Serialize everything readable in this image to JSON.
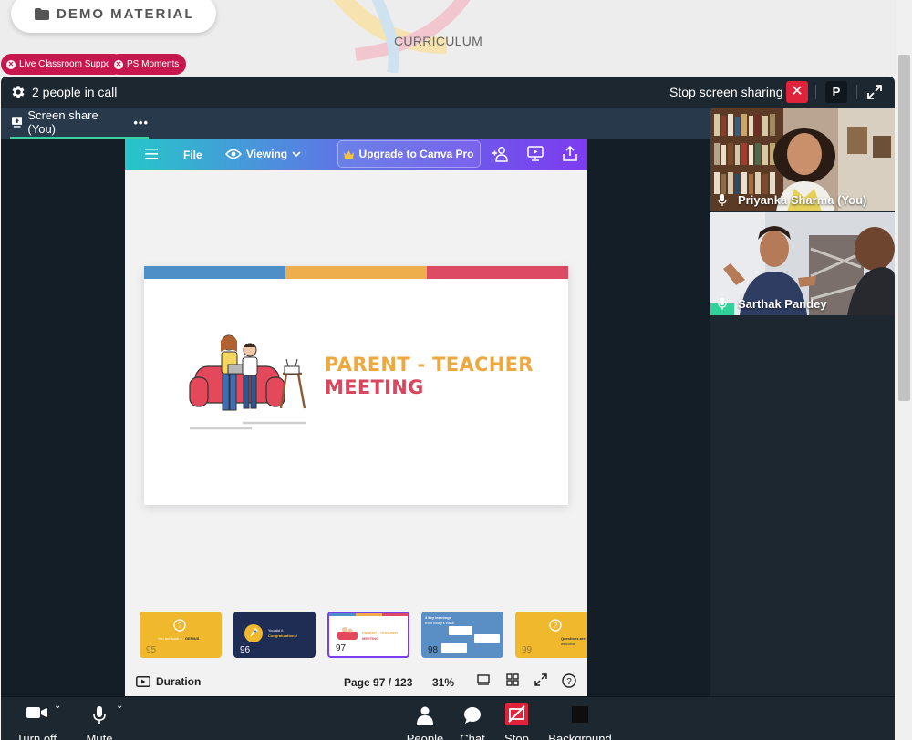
{
  "page": {
    "demo_button_label": "DEMO MATERIAL",
    "curriculum_label": "CURRICULUM",
    "chips": [
      {
        "label": "Live Classroom Support"
      },
      {
        "label": "PS Moments"
      }
    ]
  },
  "call": {
    "people_count_text": "2 people in call",
    "stop_sharing_label": "Stop screen sharing",
    "profile_initial": "P",
    "share_tab_label": "Screen share (You)",
    "share_tab_more": "•••"
  },
  "canva": {
    "file_label": "File",
    "viewing_label": "Viewing",
    "upgrade_label": "Upgrade to Canva Pro",
    "slide": {
      "title_line1": "PARENT - TEACHER",
      "title_line2": "MEETING",
      "stripe_colors": [
        "#4d8fc6",
        "#eeae4c",
        "#dc4a64"
      ]
    },
    "thumbnails": [
      {
        "number": "95",
        "bg": "#f0b82c",
        "text1": "You are such a",
        "text2": "GENIUS"
      },
      {
        "number": "96",
        "bg": "#1f2d55",
        "text1": "You did it,",
        "text2": "Congratulations!"
      },
      {
        "number": "97",
        "bg": "#ffffff",
        "text1": "PARENT - TEACHER",
        "text2": "MEETING"
      },
      {
        "number": "98",
        "bg": "#5a8fc6",
        "text1": "3 key learnings",
        "text2": "from today's class"
      },
      {
        "number": "99",
        "bg": "#f0b82c",
        "text1": "Questions are",
        "text2": "welcome"
      }
    ],
    "selected_thumbnail": "97",
    "duration_label": "Duration",
    "page_indicator": "Page 97 / 123",
    "zoom_level": "31%"
  },
  "participants": [
    {
      "name": "Priyanka Sharma (You)"
    },
    {
      "name": "Sarthak Pandey"
    }
  ],
  "controls": {
    "camera_label": "Turn off",
    "mute_label": "Mute",
    "people_label": "People",
    "chat_label": "Chat",
    "stop_label": "Stop",
    "background_label": "Background"
  }
}
